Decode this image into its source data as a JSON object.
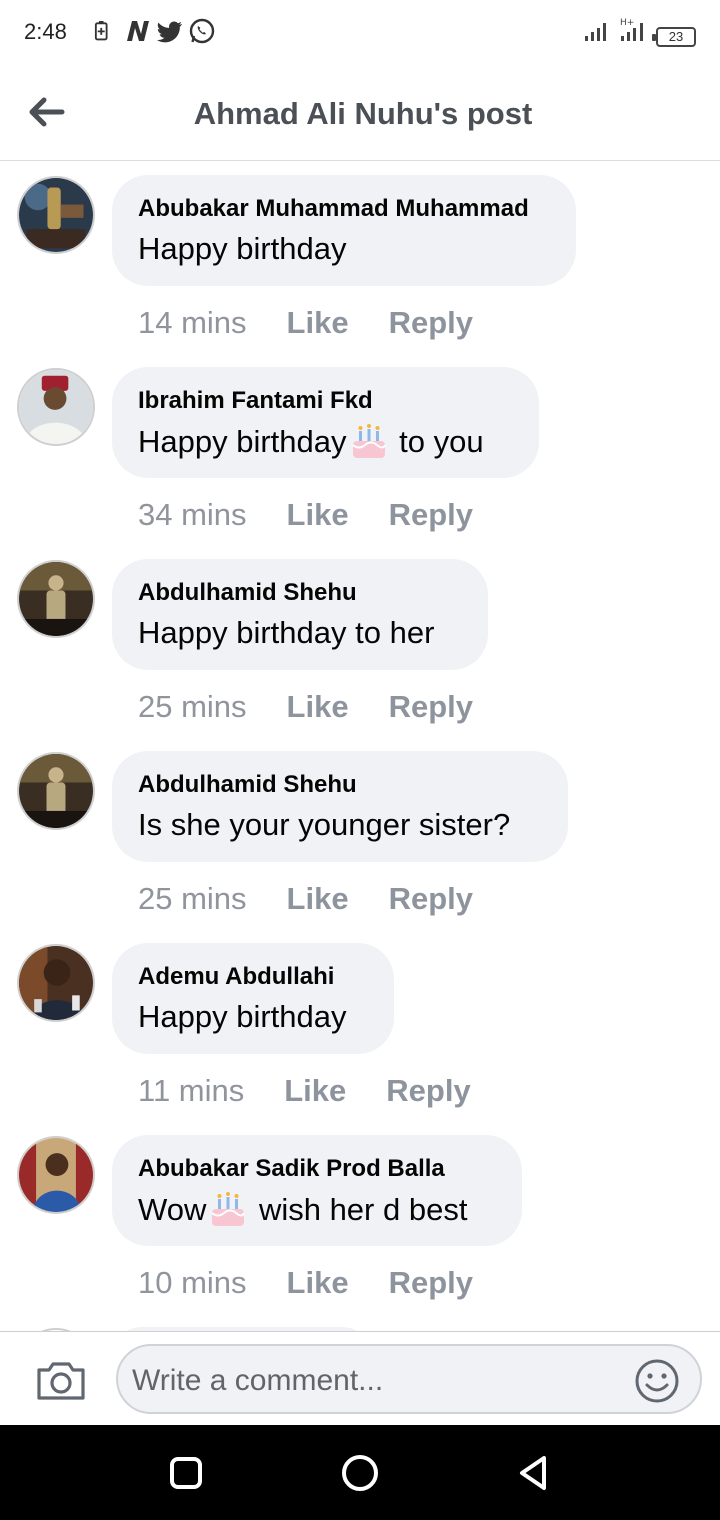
{
  "status_bar": {
    "time": "2:48",
    "battery": "23",
    "left_icons": [
      "battery-saver-icon",
      "n-app-icon",
      "twitter-icon",
      "whatsapp-icon"
    ],
    "right_icons": [
      "signal-icon",
      "signal-hplus-icon",
      "battery-icon"
    ]
  },
  "header": {
    "title": "Ahmad Ali Nuhu's post",
    "back_icon": "arrow-left-icon"
  },
  "comments": [
    {
      "author": "Abubakar Muhammad Muhammad",
      "text_before": "Happy birthday",
      "emoji": "",
      "text_after": "",
      "time": "14 mins",
      "like": "Like",
      "reply": "Reply"
    },
    {
      "author": "Ibrahim Fantami Fkd",
      "text_before": "Happy birthday",
      "emoji": "birthday-cake-emoji",
      "text_after": " to you",
      "time": "34 mins",
      "like": "Like",
      "reply": "Reply"
    },
    {
      "author": "Abdulhamid Shehu",
      "text_before": "Happy birthday to her",
      "emoji": "",
      "text_after": "",
      "time": "25 mins",
      "like": "Like",
      "reply": "Reply"
    },
    {
      "author": "Abdulhamid Shehu",
      "text_before": "Is she your younger sister?",
      "emoji": "",
      "text_after": "",
      "time": "25 mins",
      "like": "Like",
      "reply": "Reply"
    },
    {
      "author": "Ademu Abdullahi",
      "text_before": "Happy birthday",
      "emoji": "",
      "text_after": "",
      "time": "11 mins",
      "like": "Like",
      "reply": "Reply"
    },
    {
      "author": "Abubakar Sadik Prod Balla",
      "text_before": "Wow",
      "emoji": "birthday-cake-emoji",
      "text_after": " wish her d best",
      "time": "10 mins",
      "like": "Like",
      "reply": "Reply"
    }
  ],
  "composer": {
    "placeholder": "Write a comment...",
    "camera_icon": "camera-icon",
    "emoji_icon": "smiley-icon"
  },
  "navbar": {
    "icons": [
      "recents-square-icon",
      "home-circle-icon",
      "back-triangle-icon"
    ]
  },
  "colors": {
    "bubble": "#f0f2f5",
    "title": "#4b4f56",
    "meta": "#8d949e",
    "navbar": "#000000"
  }
}
